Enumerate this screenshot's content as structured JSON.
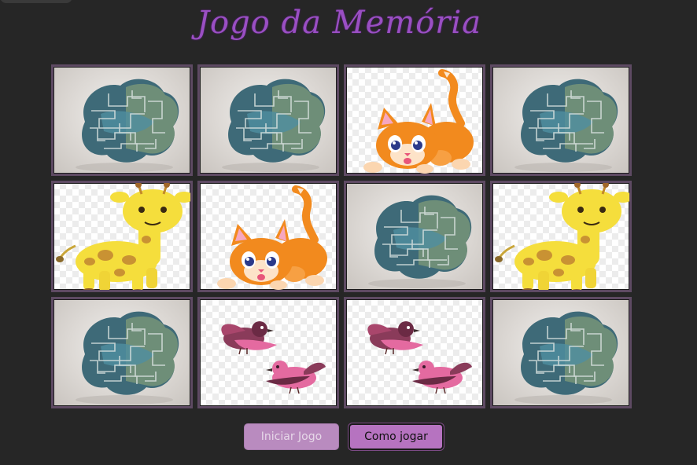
{
  "title": "Jogo da Memória",
  "buttons": {
    "start_label": "Iniciar Jogo",
    "start_disabled": true,
    "howto_label": "Como jogar"
  },
  "board": {
    "rows": 3,
    "columns": 4,
    "cards": [
      {
        "state": "face-down",
        "image": "brain-maze-icon"
      },
      {
        "state": "face-down",
        "image": "brain-maze-icon"
      },
      {
        "state": "face-up",
        "image": "kitten-icon"
      },
      {
        "state": "face-down",
        "image": "brain-maze-icon"
      },
      {
        "state": "face-up",
        "image": "giraffe-icon"
      },
      {
        "state": "face-up",
        "image": "kitten-icon"
      },
      {
        "state": "face-down",
        "image": "brain-maze-icon"
      },
      {
        "state": "face-up",
        "image": "giraffe-icon"
      },
      {
        "state": "face-down",
        "image": "brain-maze-icon"
      },
      {
        "state": "face-up",
        "image": "birds-icon"
      },
      {
        "state": "face-up",
        "image": "birds-icon"
      },
      {
        "state": "face-down",
        "image": "brain-maze-icon"
      }
    ]
  },
  "colors": {
    "background": "#262626",
    "title": "#9a4fc3",
    "card_border": "#5e4a63",
    "button_start": "#b98bbf",
    "button_howto": "#b673c0"
  }
}
